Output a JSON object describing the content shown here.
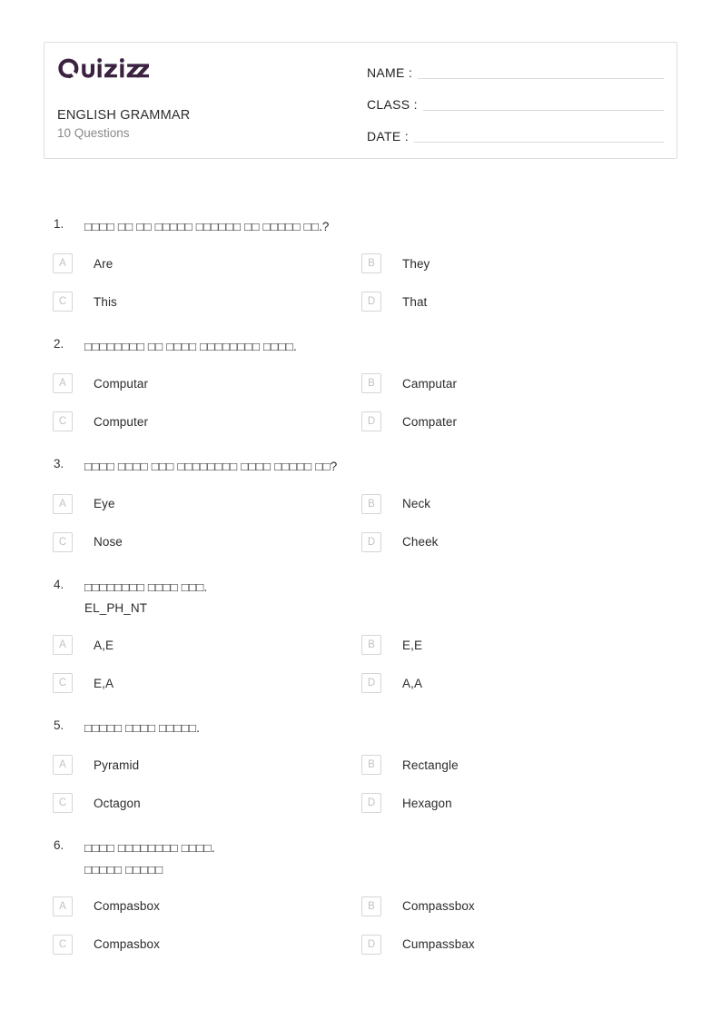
{
  "header": {
    "logo_text": "Quizizz",
    "logo_color": "#3b2240",
    "quiz_title": "ENGLISH GRAMMAR",
    "question_count": "10 Questions",
    "fields": [
      {
        "label": "NAME :",
        "value": ""
      },
      {
        "label": "CLASS :",
        "value": ""
      },
      {
        "label": "DATE  :",
        "value": ""
      }
    ]
  },
  "questions": [
    {
      "number": "1.",
      "text": "□□□□ □□ □□ □□□□□ □□□□□□ □□ □□□□□ □□.?",
      "options": [
        {
          "letter": "A",
          "text": "Are"
        },
        {
          "letter": "B",
          "text": "They"
        },
        {
          "letter": "C",
          "text": "This"
        },
        {
          "letter": "D",
          "text": "That"
        }
      ]
    },
    {
      "number": "2.",
      "text": "□□□□□□□□ □□ □□□□ □□□□□□□□ □□□□.",
      "options": [
        {
          "letter": "A",
          "text": "Computar"
        },
        {
          "letter": "B",
          "text": "Camputar"
        },
        {
          "letter": "C",
          "text": "Computer"
        },
        {
          "letter": "D",
          "text": "Compater"
        }
      ]
    },
    {
      "number": "3.",
      "text": "□□□□ □□□□ □□□ □□□□□□□□ □□□□ □□□□□ □□?",
      "options": [
        {
          "letter": "A",
          "text": "Eye"
        },
        {
          "letter": "B",
          "text": "Neck"
        },
        {
          "letter": "C",
          "text": "Nose"
        },
        {
          "letter": "D",
          "text": "Cheek"
        }
      ]
    },
    {
      "number": "4.",
      "text": "□□□□□□□□ □□□□ □□□.\nEL_PH_NT",
      "options": [
        {
          "letter": "A",
          "text": "A,E"
        },
        {
          "letter": "B",
          "text": "E,E"
        },
        {
          "letter": "C",
          "text": "E,A"
        },
        {
          "letter": "D",
          "text": "A,A"
        }
      ]
    },
    {
      "number": "5.",
      "text": "□□□□□ □□□□ □□□□□.",
      "options": [
        {
          "letter": "A",
          "text": "Pyramid"
        },
        {
          "letter": "B",
          "text": "Rectangle"
        },
        {
          "letter": "C",
          "text": "Octagon"
        },
        {
          "letter": "D",
          "text": "Hexagon"
        }
      ]
    },
    {
      "number": "6.",
      "text": "□□□□ □□□□□□□□ □□□□.\n□□□□□ □□□□□",
      "options": [
        {
          "letter": "A",
          "text": "Compasbox"
        },
        {
          "letter": "B",
          "text": "Compassbox"
        },
        {
          "letter": "C",
          "text": "Compasbox"
        },
        {
          "letter": "D",
          "text": "Cumpassbax"
        }
      ]
    }
  ]
}
